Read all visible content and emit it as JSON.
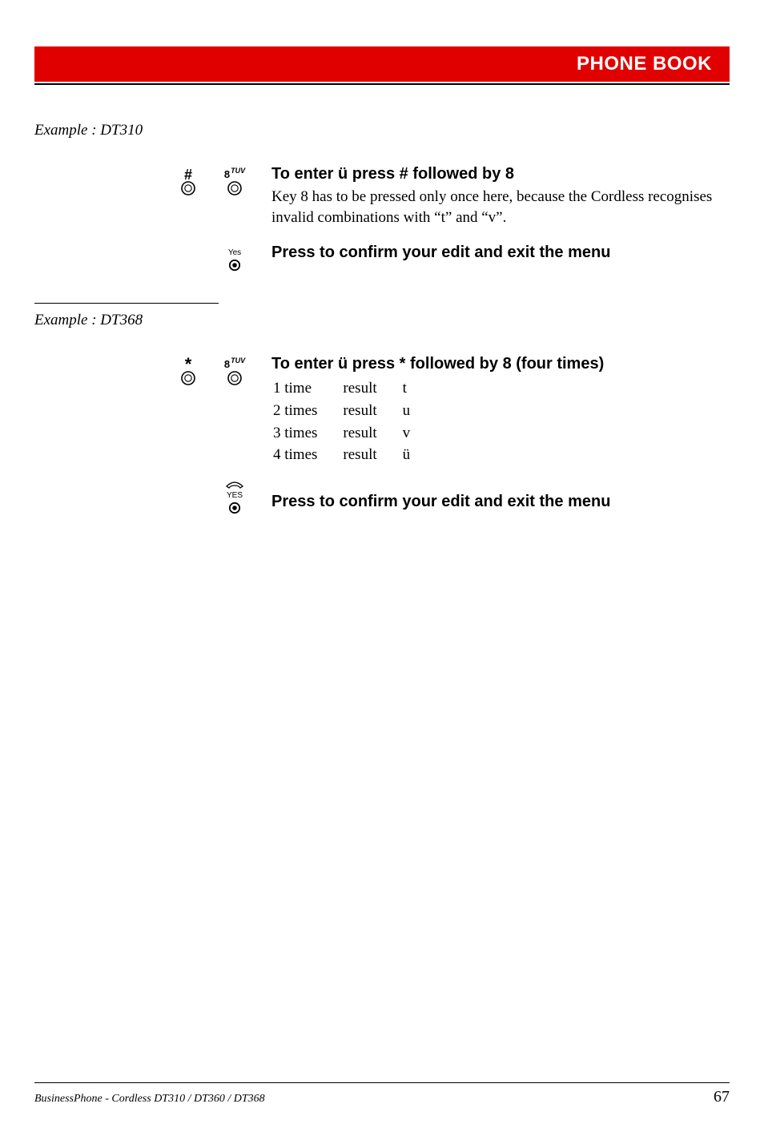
{
  "header": {
    "title": "PHONE BOOK"
  },
  "example1": {
    "label": "Example : DT310",
    "step1": {
      "key1_label": "#",
      "key2_label_main": "8",
      "key2_label_sup": "TUV",
      "heading": "To enter ü press # followed by 8",
      "body": "Key 8 has to be pressed only once here, because the Cordless recognises invalid combinations with “t” and “v”."
    },
    "step2": {
      "key_label": "Yes",
      "heading": "Press to confirm your edit and exit the menu"
    }
  },
  "example2": {
    "label": "Example : DT368",
    "step1": {
      "key1_label": "*",
      "key2_label_main": "8",
      "key2_label_sup": "TUV",
      "heading": "To enter ü press * followed by 8 (four times)",
      "rows": [
        {
          "press": "1 time",
          "res": "result",
          "char": "t"
        },
        {
          "press": "2 times",
          "res": "result",
          "char": "u"
        },
        {
          "press": "3 times",
          "res": "result",
          "char": "v"
        },
        {
          "press": "4 times",
          "res": "result",
          "char": "ü"
        }
      ]
    },
    "step2": {
      "key_label": "YES",
      "heading": "Press to confirm your edit and exit the menu"
    }
  },
  "footer": {
    "left": "BusinessPhone - Cordless DT310 / DT360 / DT368",
    "right": "67"
  }
}
